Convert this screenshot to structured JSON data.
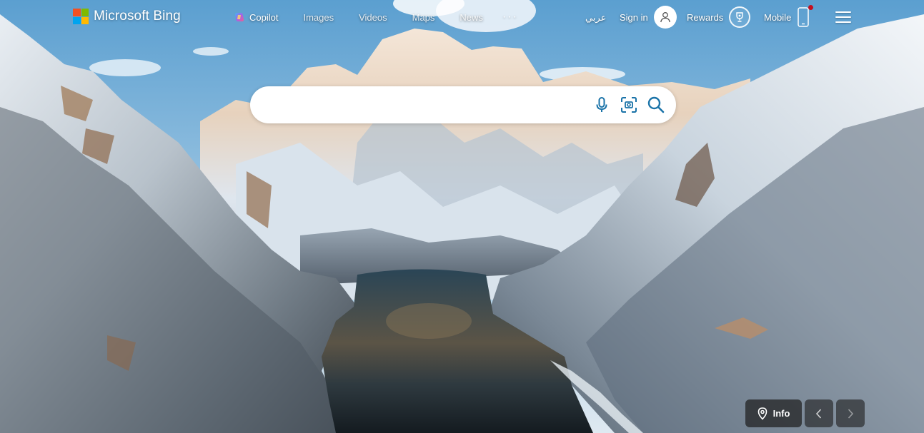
{
  "brand": {
    "logo_text": "Microsoft Bing",
    "logo_icon": "microsoft-four-squares",
    "square_colors": [
      "#f25022",
      "#7fba00",
      "#00a4ef",
      "#ffb900"
    ]
  },
  "nav": {
    "items": [
      {
        "label": "Copilot",
        "icon": "copilot-icon"
      },
      {
        "label": "Images"
      },
      {
        "label": "Videos"
      },
      {
        "label": "Maps"
      },
      {
        "label": "News"
      }
    ],
    "more_label": "···"
  },
  "right_nav": {
    "language_link": "عربي",
    "sign_in_label": "Sign in",
    "rewards_label": "Rewards",
    "mobile_label": "Mobile",
    "notification_dot_color": "#c50f1f"
  },
  "search": {
    "value": "",
    "placeholder": "",
    "icon_color": "#1a73a8",
    "icons": [
      "microphone-icon",
      "visual-search-icon",
      "search-icon"
    ]
  },
  "background": {
    "description_icon": "location-pin-icon",
    "info_label": "Info"
  },
  "carousel": {
    "prev_icon": "chevron-left-icon",
    "next_icon": "chevron-right-icon"
  }
}
